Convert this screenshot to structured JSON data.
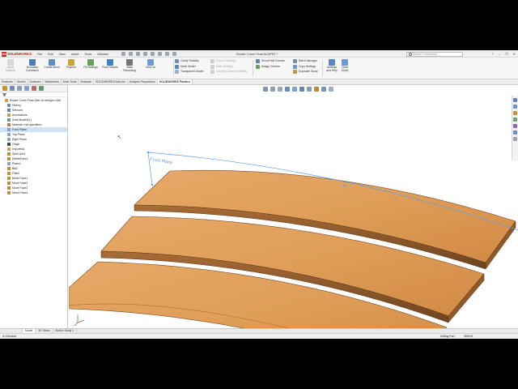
{
  "app": {
    "logo_mark": "DS",
    "logo_text": "SOLIDWORKS",
    "menu": [
      "File",
      "Edit",
      "View",
      "Insert",
      "Tools",
      "Window"
    ],
    "document_title": "Router Cover Final.SLDPRT *",
    "search_placeholder": "Search Commands",
    "window_controls": [
      "?",
      "–",
      "❐",
      "✕"
    ]
  },
  "ribbon": {
    "large_buttons": [
      {
        "label": "Apply Material",
        "icon": "apply-material-icon",
        "color": "#b8b8b8"
      },
      {
        "label": "Boundary Conditions",
        "icon": "boundary-conditions-icon",
        "color": "#4f7fb3"
      },
      {
        "label": "Create Mesh",
        "icon": "create-mesh-icon",
        "color": "#5d8fc4"
      },
      {
        "label": "Polymer",
        "icon": "polymer-icon",
        "color": "#c9a23a"
      },
      {
        "label": "Fill Settings",
        "icon": "fill-settings-icon",
        "color": "#6a9f5b"
      },
      {
        "label": "Flow Results",
        "icon": "flow-results-icon",
        "color": "#3f82c8"
      },
      {
        "label": "Video Recording",
        "icon": "video-recording-icon",
        "color": "#777777"
      },
      {
        "label": "View on",
        "icon": "view-on-icon",
        "color": "#6d9ad1"
      }
    ],
    "small_col1": [
      "Cavity Visibility",
      "Mesh Model",
      "Transparent Model"
    ],
    "small_col2": [
      "Runner Visibility",
      "Mold Visibility",
      "Cooling Channel Visibility"
    ],
    "small_col3": [
      "Show/Hide Domain",
      "Assign Domain"
    ],
    "small_col4": [
      "Batch Manager",
      "Copy Settings",
      "Duplicate Study"
    ],
    "right_buttons": [
      {
        "label": "Settings and Help",
        "icon": "settings-help-icon",
        "color": "#5b86c2"
      },
      {
        "label": "Clear Study",
        "icon": "clear-study-icon",
        "color": "#6b9bd6"
      }
    ]
  },
  "tabs": [
    "Features",
    "Sketch",
    "Surfaces",
    "Weldments",
    "Mold Tools",
    "Evaluate",
    "SOLIDWORKS Add-Ins",
    "Analysis Preparation",
    "SOLIDWORKS Plastics"
  ],
  "active_tab": "SOLIDWORKS Plastics",
  "feature_tree": [
    {
      "label": "Router Cover Final  (Mer rib design<<Def",
      "icon": "part-icon",
      "color": "#d69b3b",
      "indent": 0,
      "selected": false
    },
    {
      "label": "History",
      "icon": "history-icon",
      "color": "#7a8aa6",
      "indent": 1,
      "selected": false
    },
    {
      "label": "Sensors",
      "icon": "sensors-icon",
      "color": "#4e86c8",
      "indent": 1,
      "selected": false
    },
    {
      "label": "Annotations",
      "icon": "annotations-icon",
      "color": "#c99a3a",
      "indent": 1,
      "selected": false
    },
    {
      "label": "Solid Bodies(1)",
      "icon": "solid-bodies-icon",
      "color": "#6c8fb5",
      "indent": 1,
      "selected": false
    },
    {
      "label": "Material <not specified>",
      "icon": "material-icon",
      "color": "#b5794a",
      "indent": 1,
      "selected": false
    },
    {
      "label": "Front Plane",
      "icon": "plane-icon",
      "color": "#8aa2c0",
      "indent": 1,
      "selected": true
    },
    {
      "label": "Top Plane",
      "icon": "plane-icon",
      "color": "#8aa2c0",
      "indent": 1,
      "selected": false
    },
    {
      "label": "Right Plane",
      "icon": "plane-icon",
      "color": "#8aa2c0",
      "indent": 1,
      "selected": false
    },
    {
      "label": "Origin",
      "icon": "origin-icon",
      "color": "#444444",
      "indent": 1,
      "selected": false
    },
    {
      "label": "Imported1",
      "icon": "imported-icon",
      "color": "#c4a060",
      "indent": 1,
      "selected": false
    },
    {
      "label": "Split Line1",
      "icon": "split-line-icon",
      "color": "#c38a32",
      "indent": 1,
      "selected": false
    },
    {
      "label": "DeleteFace1",
      "icon": "delete-face-icon",
      "color": "#c38a32",
      "indent": 1,
      "selected": false
    },
    {
      "label": "Plane1",
      "icon": "plane-icon",
      "color": "#8aa2c0",
      "indent": 1,
      "selected": false
    },
    {
      "label": "Bld1",
      "icon": "body-icon",
      "color": "#c38a32",
      "indent": 1,
      "selected": false
    },
    {
      "label": "Fillet1",
      "icon": "fillet-icon",
      "color": "#c38a32",
      "indent": 1,
      "selected": false
    },
    {
      "label": "Move Face1",
      "icon": "move-face-icon",
      "color": "#c38a32",
      "indent": 1,
      "selected": false
    },
    {
      "label": "Move Face2",
      "icon": "move-face-icon",
      "color": "#c38a32",
      "indent": 1,
      "selected": false
    },
    {
      "label": "Move Face3",
      "icon": "move-face-icon",
      "color": "#c38a32",
      "indent": 1,
      "selected": false
    },
    {
      "label": "Move Face4",
      "icon": "move-face-icon",
      "color": "#c38a32",
      "indent": 1,
      "selected": false
    }
  ],
  "viewport": {
    "plane_label": "Front Plane",
    "plane_color": "#5aa0e6",
    "part_top_color": "#e0a05c",
    "part_side_color": "#9c6330",
    "part_edge_color": "#6e4420"
  },
  "bottom_tabs": [
    "Model",
    "3D Views",
    "Motion Study 1"
  ],
  "active_bottom_tab": "Model",
  "status": {
    "left": "In Checked",
    "right": [
      "Editing Part",
      "MMGS"
    ]
  }
}
